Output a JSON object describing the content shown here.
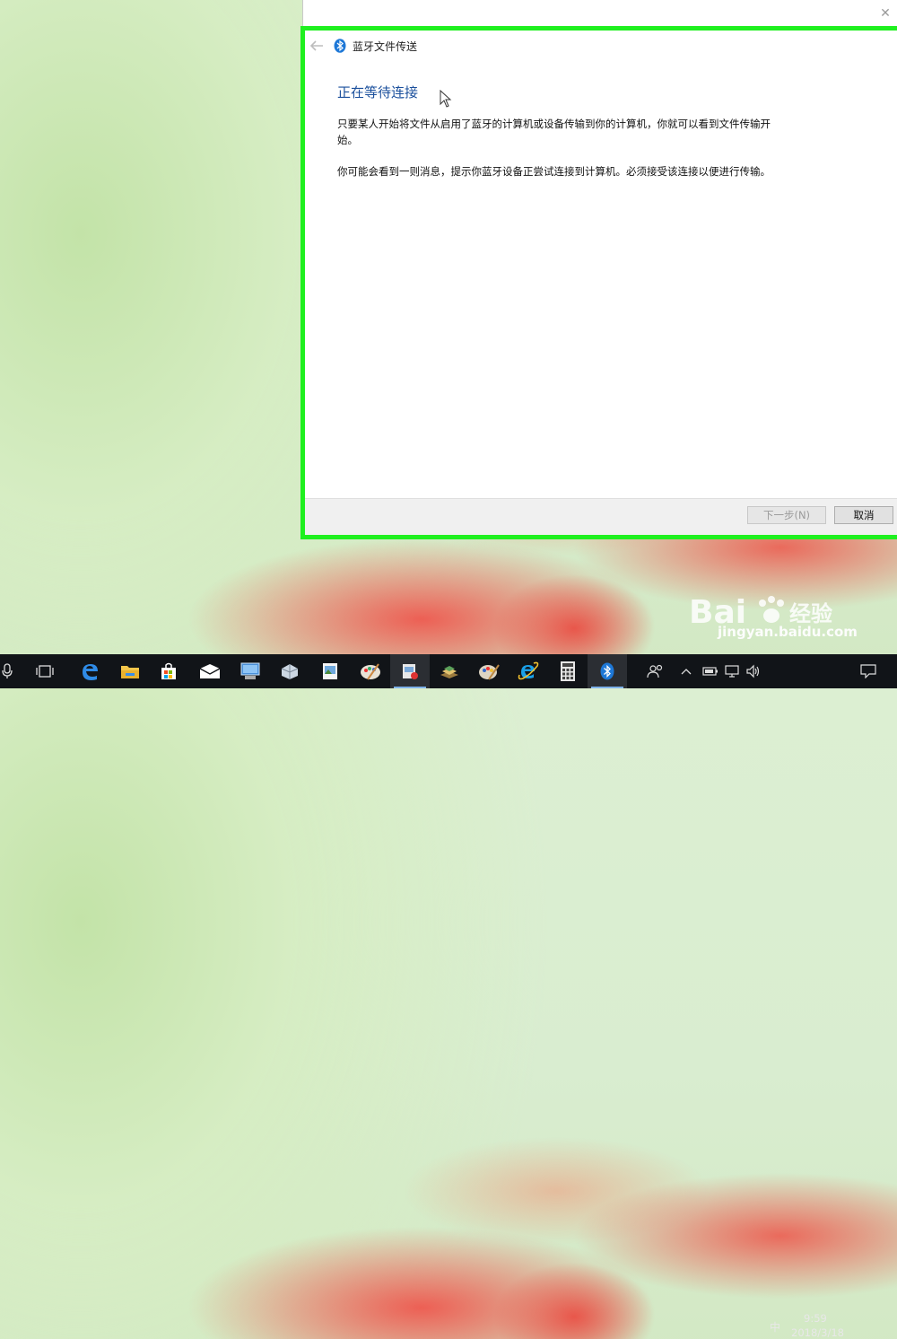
{
  "window": {
    "title": "蓝牙文件传送",
    "close_glyph": "✕",
    "heading": "正在等待连接",
    "para1": "只要某人开始将文件从启用了蓝牙的计算机或设备传输到你的计算机，你就可以看到文件传输开始。",
    "para2": "你可能会看到一则消息，提示你蓝牙设备正尝试连接到计算机。必须接受该连接以便进行传输。",
    "next_button": "下一步(N)",
    "cancel_button": "取消"
  },
  "watermark": {
    "logo": "Bai",
    "logo_cn": "经验",
    "url": "jingyan.baidu.com"
  },
  "taskbar": {
    "items": [
      "microphone-icon",
      "task-view-icon",
      "edge-icon",
      "file-explorer-icon",
      "store-icon",
      "mail-icon",
      "computer-icon",
      "3d-builder-icon",
      "image-viewer-icon",
      "paint-icon",
      "media-icon",
      "books-icon",
      "paint-palette-icon",
      "ie-icon",
      "calculator-icon",
      "bluetooth-icon"
    ],
    "ime": "中",
    "time": "9:59",
    "date": "2018/3/18"
  },
  "colors": {
    "highlight_border": "#1ff01f",
    "heading": "#1a4f9c",
    "bluetooth": "#1e78d7",
    "taskbar": "#111418"
  }
}
